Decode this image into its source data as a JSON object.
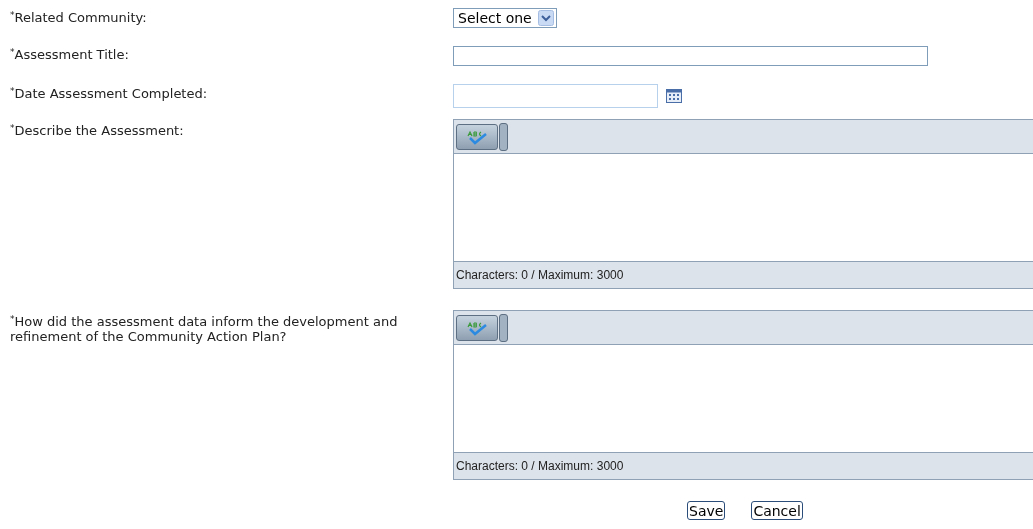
{
  "fields": [
    {
      "kind": "select",
      "label": "$^{*}$Related Community:",
      "value": "Select one"
    },
    {
      "kind": "text",
      "label": "$^{*}$Assessment Title:"
    },
    {
      "kind": "date",
      "label": "$^{*}$Date Assessment Completed:"
    },
    {
      "kind": "richtext",
      "label": "$^{*}$Describe the Assessment:",
      "counter": "Characters: 0 / Maximum: 3000"
    },
    {
      "kind": "richtext",
      "label": "$^{*}$How did the assessment data inform the development and refinement of the Community Action Plan?",
      "counter": "Characters: 0 / Maximum: 3000"
    }
  ],
  "buttons": [
    "Save",
    "Cancel"
  ]
}
